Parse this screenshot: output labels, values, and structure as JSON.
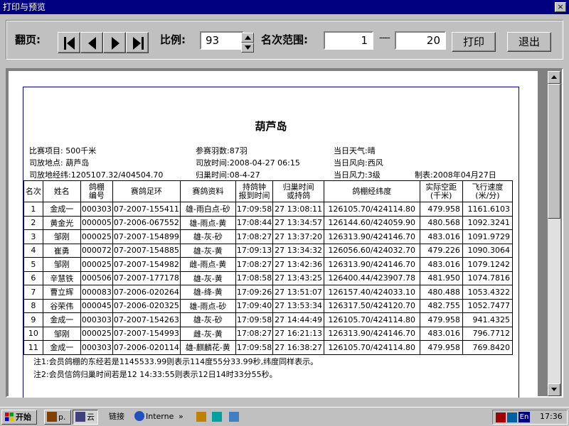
{
  "window": {
    "title": "打印与预览",
    "close_glyph": "×"
  },
  "toolbar": {
    "page_label": "翻页:",
    "scale_label": "比例:",
    "scale_value": "93",
    "range_label": "名次范围:",
    "range_from": "1",
    "range_sep": "----",
    "range_to": "20",
    "print_label": "打印",
    "exit_label": "退出"
  },
  "report": {
    "title": "葫芦岛",
    "info": {
      "race_item": "比赛项目:  500千米",
      "release_place": "司放地点:  葫芦岛",
      "release_coords": "司放地经纬:1205107.32/404504.70",
      "entries": "参赛羽数:87羽",
      "release_time": "司放时间:2008-04-27  06:15",
      "return_date": "归巢时间:08-4-27",
      "weather": "当日天气:晴",
      "wind_dir": "当日风向:西风",
      "wind_force": "当日风力:3级",
      "made_by": "制表:2008年04月27日"
    },
    "headers": {
      "rank": "名次",
      "name": "姓名",
      "loft_no": [
        "鸽棚",
        "编号"
      ],
      "ring": "赛鸽足环",
      "info": "赛鸽资料",
      "clock": [
        "持鸽钟",
        "报到时间"
      ],
      "arrival": [
        "归巢时间",
        "或持鸽"
      ],
      "coords": "鸽棚经纬度",
      "distance": [
        "实际空距",
        "(千米)"
      ],
      "speed": [
        "飞行速度",
        "(米/分)"
      ]
    },
    "rows": [
      {
        "rank": "1",
        "name": "金成一",
        "loft": "000303",
        "ring": "07-2007-155411",
        "info": "雄-雨白点-砂",
        "clock": "17:09:58",
        "arrival": "27 13:08:11",
        "coords": "126105.70/424114.80",
        "distance": "479.958",
        "speed": "1161.6103"
      },
      {
        "rank": "2",
        "name": "黄金光",
        "loft": "000005",
        "ring": "07-2006-067552",
        "info": "雄-雨点-黄",
        "clock": "17:08:44",
        "arrival": "27 13:34:57",
        "coords": "126144.60/424059.90",
        "distance": "480.568",
        "speed": "1092.3241"
      },
      {
        "rank": "3",
        "name": "邹刚",
        "loft": "000025",
        "ring": "07-2007-154899",
        "info": "雄-灰-砂",
        "clock": "17:08:27",
        "arrival": "27 13:37:20",
        "coords": "126313.90/424146.70",
        "distance": "483.016",
        "speed": "1091.9729"
      },
      {
        "rank": "4",
        "name": "崔勇",
        "loft": "000072",
        "ring": "07-2007-154885",
        "info": "雄-灰-黄",
        "clock": "17:09:13",
        "arrival": "27 13:34:32",
        "coords": "126056.60/424032.70",
        "distance": "479.226",
        "speed": "1090.3064"
      },
      {
        "rank": "5",
        "name": "邹刚",
        "loft": "000025",
        "ring": "07-2007-154982",
        "info": "雌-雨点-黄",
        "clock": "17:08:27",
        "arrival": "27 13:42:36",
        "coords": "126313.90/424146.70",
        "distance": "483.016",
        "speed": "1079.1242"
      },
      {
        "rank": "6",
        "name": "辛慧铁",
        "loft": "000506",
        "ring": "07-2007-177178",
        "info": "雄-灰-黄",
        "clock": "17:08:58",
        "arrival": "27 13:43:25",
        "coords": "126400.44/423907.78",
        "distance": "481.950",
        "speed": "1074.7816"
      },
      {
        "rank": "7",
        "name": "曹立辉",
        "loft": "000083",
        "ring": "07-2006-020264",
        "info": "雄-绛-黄",
        "clock": "17:09:26",
        "arrival": "27 13:51:07",
        "coords": "126157.40/424033.10",
        "distance": "480.488",
        "speed": "1053.4322"
      },
      {
        "rank": "8",
        "name": "谷荣伟",
        "loft": "000045",
        "ring": "07-2006-020325",
        "info": "雄-雨点-砂",
        "clock": "17:09:40",
        "arrival": "27 13:53:34",
        "coords": "126317.50/424120.70",
        "distance": "482.755",
        "speed": "1052.7477"
      },
      {
        "rank": "9",
        "name": "金成一",
        "loft": "000303",
        "ring": "07-2007-154263",
        "info": "雄-灰-砂",
        "clock": "17:09:58",
        "arrival": "27 14:44:49",
        "coords": "126105.70/424114.80",
        "distance": "479.958",
        "speed": "941.4325"
      },
      {
        "rank": "10",
        "name": "邹刚",
        "loft": "000025",
        "ring": "07-2007-154993",
        "info": "雌-灰-黄",
        "clock": "17:08:27",
        "arrival": "27 16:21:13",
        "coords": "126313.90/424146.70",
        "distance": "483.016",
        "speed": "796.7712"
      },
      {
        "rank": "11",
        "name": "金成一",
        "loft": "000303",
        "ring": "07-2006-020114",
        "info": "雄-麒麟花-黄",
        "clock": "17:09:58",
        "arrival": "27 16:38:27",
        "coords": "126105.70/424114.80",
        "distance": "479.958",
        "speed": "769.8420"
      }
    ],
    "notes": [
      "注1:会员鸽棚的东经若是1145533.99则表示114度55分33.99秒,纬度同样表示。",
      "注2:会员信鸽归巢时间若是12 14:33:55则表示12日14时33分55秒。"
    ]
  },
  "taskbar": {
    "start": "开始",
    "task1": "p.",
    "task2": "云",
    "links": "链接",
    "ie": "Interne",
    "chevron": "»",
    "ime": "En",
    "clock": "17:36"
  },
  "colors": {
    "title_bar": "#000080",
    "face": "#c0c0c0",
    "frame": "#000080"
  }
}
